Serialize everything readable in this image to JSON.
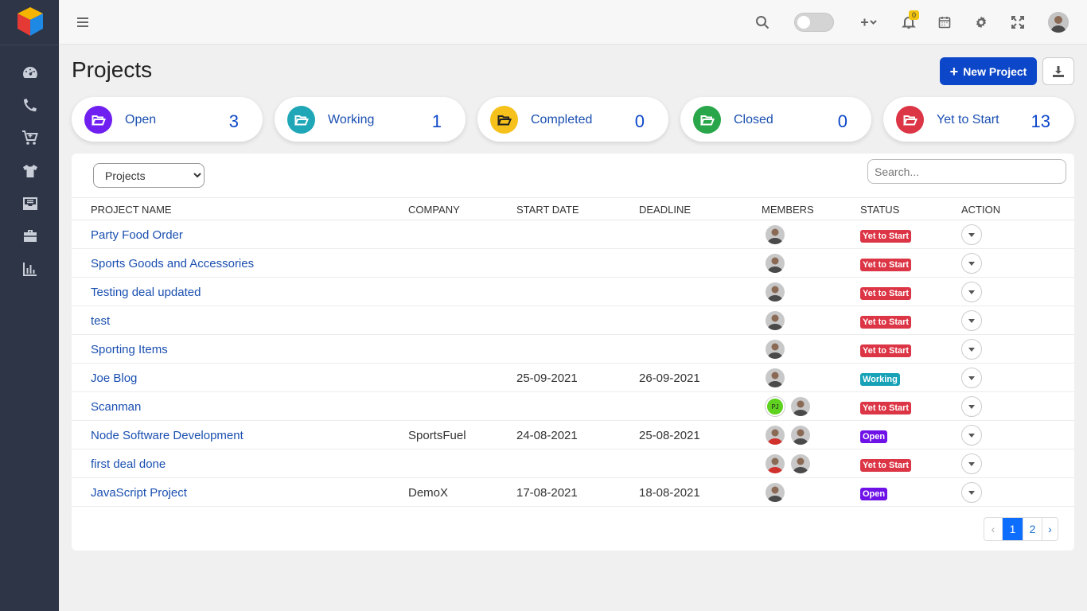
{
  "sidebar": {
    "items": [
      {
        "name": "dashboard",
        "icon": "gauge-icon"
      },
      {
        "name": "calls",
        "icon": "phone-icon"
      },
      {
        "name": "orders",
        "icon": "cart-icon"
      },
      {
        "name": "products",
        "icon": "tshirt-icon"
      },
      {
        "name": "inbox",
        "icon": "inbox-icon"
      },
      {
        "name": "projects",
        "icon": "briefcase-icon"
      },
      {
        "name": "reports",
        "icon": "chart-icon"
      }
    ]
  },
  "header": {
    "notification_count": "0"
  },
  "page": {
    "title": "Projects",
    "new_button": "New Project"
  },
  "stats": [
    {
      "label": "Open",
      "count": "3",
      "color": "#6f1ff0"
    },
    {
      "label": "Working",
      "count": "1",
      "color": "#1fa7b8"
    },
    {
      "label": "Completed",
      "count": "0",
      "color": "#f5c11a"
    },
    {
      "label": "Closed",
      "count": "0",
      "color": "#29a64a"
    },
    {
      "label": "Yet to Start",
      "count": "13",
      "color": "#dc3545"
    }
  ],
  "filter": {
    "selected": "Projects",
    "search_placeholder": "Search..."
  },
  "table": {
    "headers": [
      "PROJECT NAME",
      "COMPANY",
      "START DATE",
      "DEADLINE",
      "MEMBERS",
      "STATUS",
      "ACTION"
    ],
    "rows": [
      {
        "name": "Party Food Order",
        "company": "",
        "start": "",
        "deadline": "",
        "members": [
          "photo"
        ],
        "status": "Yet to Start"
      },
      {
        "name": "Sports Goods and Accessories",
        "company": "",
        "start": "",
        "deadline": "",
        "members": [
          "photo"
        ],
        "status": "Yet to Start"
      },
      {
        "name": "Testing deal updated",
        "company": "",
        "start": "",
        "deadline": "",
        "members": [
          "photo"
        ],
        "status": "Yet to Start"
      },
      {
        "name": "test",
        "company": "",
        "start": "",
        "deadline": "",
        "members": [
          "photo"
        ],
        "status": "Yet to Start"
      },
      {
        "name": "Sporting Items",
        "company": "",
        "start": "",
        "deadline": "",
        "members": [
          "photo"
        ],
        "status": "Yet to Start"
      },
      {
        "name": "Joe Blog",
        "company": "",
        "start": "25-09-2021",
        "deadline": "26-09-2021",
        "members": [
          "photo"
        ],
        "status": "Working"
      },
      {
        "name": "Scanman",
        "company": "",
        "start": "",
        "deadline": "",
        "members": [
          "PJ",
          "photo"
        ],
        "status": "Yet to Start"
      },
      {
        "name": "Node Software Development",
        "company": "SportsFuel",
        "start": "24-08-2021",
        "deadline": "25-08-2021",
        "members": [
          "photo-red",
          "photo"
        ],
        "status": "Open"
      },
      {
        "name": "first deal done",
        "company": "",
        "start": "",
        "deadline": "",
        "members": [
          "photo-red",
          "photo"
        ],
        "status": "Yet to Start"
      },
      {
        "name": "JavaScript Project",
        "company": "DemoX",
        "start": "17-08-2021",
        "deadline": "18-08-2021",
        "members": [
          "photo"
        ],
        "status": "Open"
      }
    ]
  },
  "status_colors": {
    "Yet to Start": "#dc3545",
    "Working": "#17a2b8",
    "Open": "#6f12e8"
  },
  "pagination": {
    "prev": "‹",
    "pages": [
      "1",
      "2"
    ],
    "current": "1",
    "next": "›"
  }
}
